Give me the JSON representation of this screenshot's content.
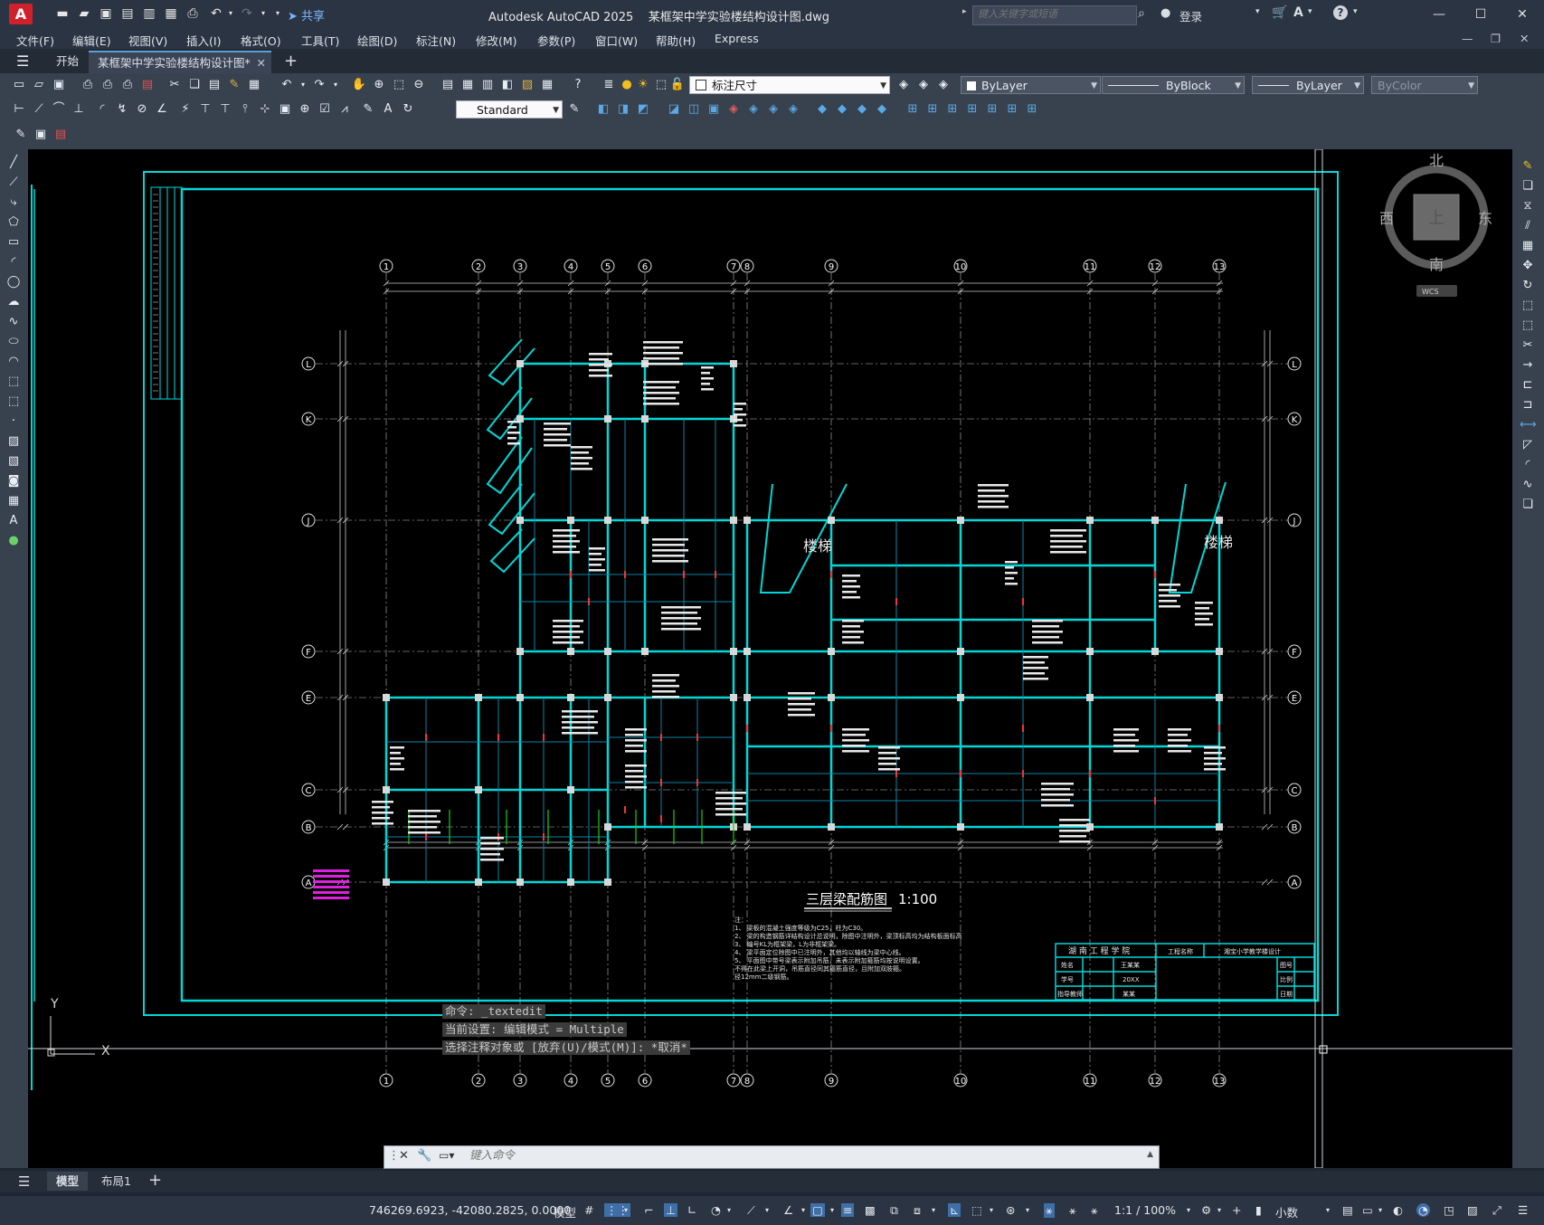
{
  "app": {
    "logo_letter": "A",
    "title": "Autodesk AutoCAD 2025    某框架中学实验楼结构设计图.dwg",
    "share_label": "共享",
    "search_placeholder": "键入关键字或短语",
    "login_label": "登录"
  },
  "menus": [
    "文件(F)",
    "编辑(E)",
    "视图(V)",
    "插入(I)",
    "格式(O)",
    "工具(T)",
    "绘图(D)",
    "标注(N)",
    "修改(M)",
    "参数(P)",
    "窗口(W)",
    "帮助(H)",
    "Express"
  ],
  "tabs": {
    "start": "开始",
    "document": "某框架中学实验楼结构设计图*"
  },
  "toolbar": {
    "dimstyle_layer": "标注尺寸",
    "color": "ByLayer",
    "linetype": "ByBlock",
    "lineweight": "ByLayer",
    "plotstyle": "ByColor",
    "textstyle": "Standard"
  },
  "viewcube": {
    "north": "北",
    "south": "南",
    "east": "东",
    "west": "西",
    "top": "上",
    "wcs": "WCS"
  },
  "drawing": {
    "axis_top": [
      "1",
      "2",
      "3",
      "4",
      "5",
      "6",
      "7",
      "8",
      "9",
      "10",
      "11",
      "12",
      "13"
    ],
    "axis_side": [
      "L",
      "K",
      "J",
      "F",
      "E",
      "C",
      "B",
      "A"
    ],
    "stair_label": "楼梯",
    "plan_title": "三层梁配筋图",
    "scale": "1:100",
    "note_lines": [
      "注：",
      "1、 梁板的混凝土强度等级为C25，柱为C30。",
      "2、 梁的构造钢筋详结构设计总说明，除图中注明外，梁顶标高均为结构板面标高",
      "3、 编号KL为框架梁，L为非框架梁。",
      "4、 梁平面定位除图中已注明外，其他均以轴线为梁中心线。",
      "5、 平面图中带号梁表示附加吊筋，未表示附加箍筋均按说明设置。",
      "   不得在此梁上开洞，吊筋直径同其箍筋直径，且附加双肢箍。",
      "   径12mm二级钢筋。"
    ],
    "titleblock": {
      "school": "湖 南 工 程 学 院",
      "project_label": "工程名称",
      "project_name": "湘宝小学教学楼设计",
      "r1": "姓名",
      "r2": "学号",
      "r3": "指导教师",
      "v1": "王某某",
      "v2": "20XX",
      "v3": "某某",
      "c1": "图号",
      "c2": "比例",
      "c3": "日期"
    },
    "ucs_y": "Y",
    "ucs_x": "X"
  },
  "command": {
    "history": [
      "命令: _textedit",
      "当前设置: 编辑模式 = Multiple",
      "选择注释对象或 [放弃(U)/模式(M)]: *取消*"
    ],
    "input_placeholder": "键入命令"
  },
  "layouts": {
    "model": "模型",
    "layout1": "布局1"
  },
  "status": {
    "coords": "746269.6923, -42080.2825, 0.0000",
    "space": "模型",
    "scale": "1:1 / 100%",
    "units": "小数"
  }
}
